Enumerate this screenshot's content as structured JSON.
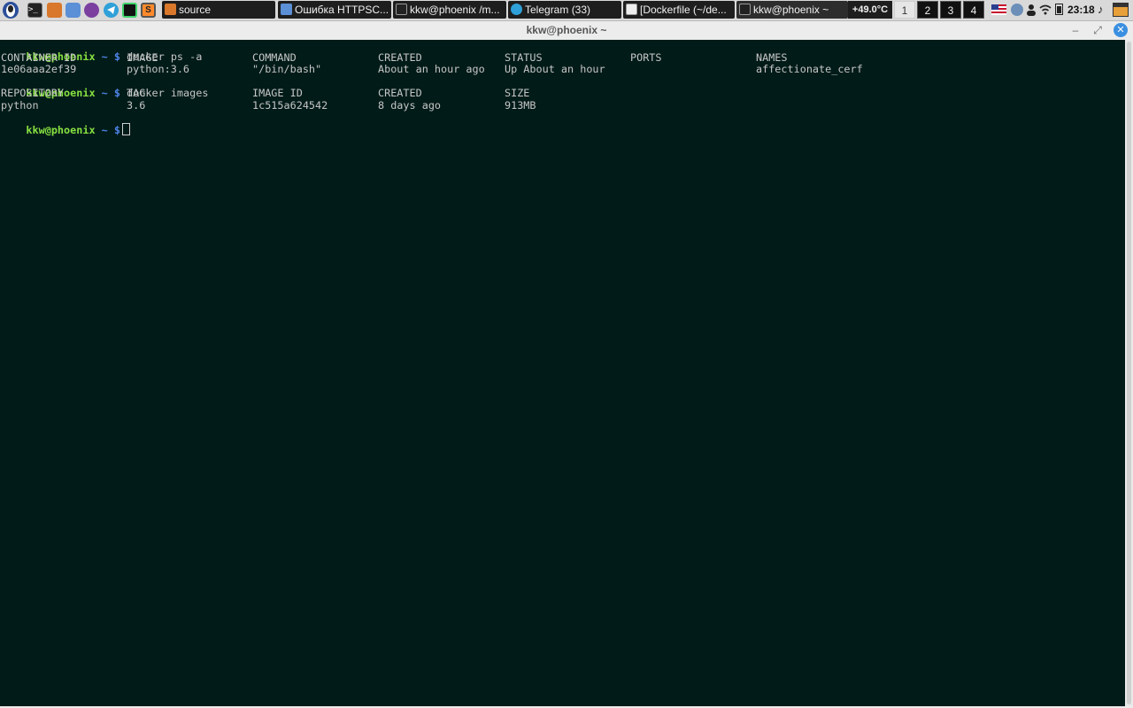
{
  "taskbar": {
    "launchers": [
      "menu-icon",
      "terminal-icon",
      "files-icon",
      "browser-icon",
      "tor-icon",
      "telegram-icon",
      "pycharm-icon",
      "sublime-icon"
    ],
    "tasks": [
      {
        "label": "source",
        "icon": "folder-icon"
      },
      {
        "label": "Ошибка HTTPSC...",
        "icon": "browser-icon"
      },
      {
        "label": "kkw@phoenix /m...",
        "icon": "terminal-icon"
      },
      {
        "label": "Telegram (33)",
        "icon": "telegram-icon"
      },
      {
        "label": "[Dockerfile (~/de...",
        "icon": "editor-icon"
      },
      {
        "label": "kkw@phoenix ~",
        "icon": "terminal-icon"
      }
    ],
    "temperature": "+49.0°C",
    "workspaces": [
      "1",
      "2",
      "3",
      "4"
    ],
    "active_workspace": "1",
    "tray_icons": [
      "us-flag-icon",
      "network-icon",
      "user-icon",
      "wifi-icon",
      "battery-icon"
    ],
    "clock": "23:18",
    "extra_icons": [
      "music-icon",
      "power-icon"
    ]
  },
  "window": {
    "title": "kkw@phoenix ~",
    "buttons": {
      "minimize": "–",
      "maximize": "⤢",
      "close": "✕"
    }
  },
  "colors": {
    "terminal_bg": "#001b18",
    "prompt_user": "#88e040",
    "prompt_path": "#4f84e8",
    "text": "#c6c6c6"
  },
  "terminal": {
    "prompt": {
      "user": "kkw@phoenix",
      "path": "~",
      "symbol": "$"
    },
    "commands": [
      "docker ps -a",
      "docker images"
    ],
    "ps_header": [
      "CONTAINER ID",
      "IMAGE",
      "COMMAND",
      "CREATED",
      "STATUS",
      "PORTS",
      "NAMES"
    ],
    "ps_rows": [
      [
        "1e06aaa2ef39",
        "python:3.6",
        "\"/bin/bash\"",
        "About an hour ago",
        "Up About an hour",
        "",
        "affectionate_cerf"
      ]
    ],
    "images_header": [
      "REPOSITORY",
      "TAG",
      "IMAGE ID",
      "CREATED",
      "SIZE"
    ],
    "images_rows": [
      [
        "python",
        "3.6",
        "1c515a624542",
        "8 days ago",
        "913MB"
      ]
    ]
  }
}
